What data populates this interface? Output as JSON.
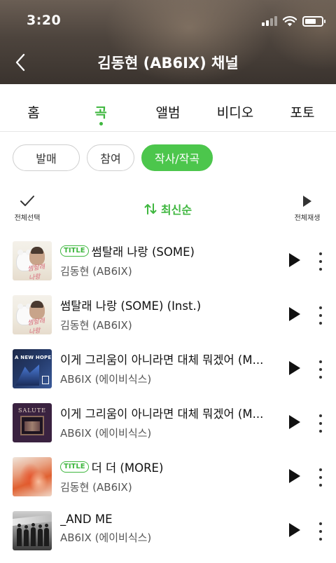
{
  "status_bar": {
    "time": "3:20"
  },
  "header": {
    "title": "김동현 (AB6IX) 채널"
  },
  "tabs": [
    {
      "label": "홈",
      "active": false
    },
    {
      "label": "곡",
      "active": true
    },
    {
      "label": "앨범",
      "active": false
    },
    {
      "label": "비디오",
      "active": false
    },
    {
      "label": "포토",
      "active": false
    }
  ],
  "filters": [
    {
      "label": "발매",
      "active": false
    },
    {
      "label": "참여",
      "active": false
    },
    {
      "label": "작사/작곡",
      "active": true
    }
  ],
  "toolbar": {
    "select_all_label": "전체선택",
    "sort_label": "최신순",
    "play_all_label": "전체재생"
  },
  "songs": [
    {
      "title": "썸탈래 나랑 (SOME)",
      "artist": "김동현 (AB6IX)",
      "badge": "TITLE",
      "art": "art-some"
    },
    {
      "title": "썸탈래 나랑 (SOME) (Inst.)",
      "artist": "김동현 (AB6IX)",
      "badge": "",
      "art": "art-some"
    },
    {
      "title": "이게 그리움이 아니라면 대체 뭐겠어 (M...",
      "artist": "AB6IX (에이비식스)",
      "badge": "",
      "art": "art-hope"
    },
    {
      "title": "이게 그리움이 아니라면 대체 뭐겠어 (M...",
      "artist": "AB6IX (에이비식스)",
      "badge": "",
      "art": "art-salute"
    },
    {
      "title": "더 더 (MORE)",
      "artist": "김동현 (AB6IX)",
      "badge": "TITLE",
      "art": "art-more"
    },
    {
      "title": "_AND ME",
      "artist": "AB6IX (에이비식스)",
      "badge": "",
      "art": "art-andme"
    }
  ],
  "album_art_text": {
    "some_script": "썸탈래 나랑",
    "hope": "A NEW HOPE",
    "salute": "SALUTE"
  },
  "colors": {
    "accent": "#3fb73f",
    "chip_active": "#4cc64c",
    "header_bg": "#4d443d"
  },
  "icons": {
    "back": "chevron-left-icon",
    "select_all": "check-icon",
    "sort": "sort-arrows-icon",
    "play_all": "play-icon",
    "row_play": "play-icon",
    "row_more": "more-vertical-icon"
  }
}
